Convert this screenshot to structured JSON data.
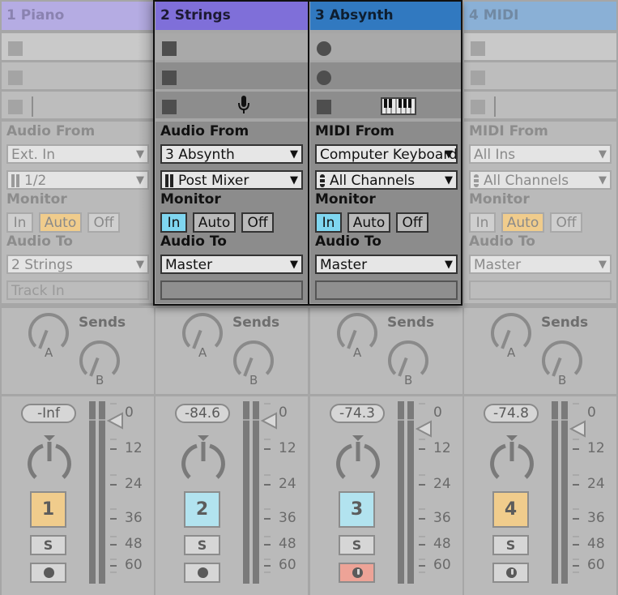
{
  "tracks": [
    {
      "name": "1 Piano",
      "selected": false,
      "header_color": "#b5ace3",
      "header_text_color": "#8a82b0",
      "clip_slots": [
        {
          "type": "stop"
        },
        {
          "type": "stop"
        },
        {
          "type": "stop",
          "extra": "divider-bar"
        }
      ],
      "input_label": "Audio From",
      "input_type": "Ext. In",
      "input_channel": "1/2",
      "input_channel_icon": "stereo-input-icon",
      "monitor_label": "Monitor",
      "monitor_options": [
        "In",
        "Auto",
        "Off"
      ],
      "monitor_active": "Auto",
      "output_label": "Audio To",
      "output_target": "2 Strings",
      "output_sub": "Track In",
      "sends_label": "Sends",
      "sends": [
        {
          "name": "A"
        },
        {
          "name": "B"
        }
      ],
      "volume": "-Inf",
      "track_number": "1",
      "activator_color": "#f0cc8c",
      "solo_label": "S",
      "arm_icon": "record-arm-icon",
      "arm_active": false,
      "meter_scale": [
        "0",
        "12",
        "24",
        "36",
        "48",
        "60"
      ]
    },
    {
      "name": "2 Strings",
      "selected": true,
      "header_color": "#7f6fd9",
      "header_text_color": "#1d1a33",
      "clip_slots": [
        {
          "type": "stop"
        },
        {
          "type": "stop"
        },
        {
          "type": "stop",
          "extra": "microphone-icon"
        }
      ],
      "input_label": "Audio From",
      "input_type": "3 Absynth",
      "input_channel": "Post Mixer",
      "input_channel_icon": "stereo-input-icon",
      "monitor_label": "Monitor",
      "monitor_options": [
        "In",
        "Auto",
        "Off"
      ],
      "monitor_active": "In",
      "output_label": "Audio To",
      "output_target": "Master",
      "output_sub": "",
      "sends_label": "Sends",
      "sends": [
        {
          "name": "A"
        },
        {
          "name": "B"
        }
      ],
      "volume": "-84.6",
      "track_number": "2",
      "activator_color": "#b2e3ef",
      "solo_label": "S",
      "arm_icon": "record-arm-icon",
      "arm_active": false,
      "meter_scale": [
        "0",
        "12",
        "24",
        "36",
        "48",
        "60"
      ]
    },
    {
      "name": "3 Absynth",
      "selected": true,
      "header_color": "#3179c0",
      "header_text_color": "#0e1e30",
      "clip_slots": [
        {
          "type": "record"
        },
        {
          "type": "record"
        },
        {
          "type": "stop",
          "extra": "keyboard-icon"
        }
      ],
      "input_label": "MIDI From",
      "input_type": "Computer Keyboard",
      "input_channel": "All Channels",
      "input_channel_icon": "midi-channel-icon",
      "monitor_label": "Monitor",
      "monitor_options": [
        "In",
        "Auto",
        "Off"
      ],
      "monitor_active": "In",
      "output_label": "Audio To",
      "output_target": "Master",
      "output_sub": "",
      "sends_label": "Sends",
      "sends": [
        {
          "name": "A"
        },
        {
          "name": "B"
        }
      ],
      "volume": "-74.3",
      "track_number": "3",
      "activator_color": "#b2e3ef",
      "solo_label": "S",
      "arm_icon": "midi-arm-icon",
      "arm_active": true,
      "meter_scale": [
        "0",
        "12",
        "24",
        "36",
        "48",
        "60"
      ]
    },
    {
      "name": "4 MIDI",
      "selected": false,
      "header_color": "#8ab0d6",
      "header_text_color": "#7189a3",
      "clip_slots": [
        {
          "type": "stop"
        },
        {
          "type": "stop"
        },
        {
          "type": "stop",
          "extra": "divider-bar"
        }
      ],
      "input_label": "MIDI From",
      "input_type": "All Ins",
      "input_channel": "All Channels",
      "input_channel_icon": "midi-channel-icon",
      "monitor_label": "Monitor",
      "monitor_options": [
        "In",
        "Auto",
        "Off"
      ],
      "monitor_active": "Auto",
      "output_label": "Audio To",
      "output_target": "Master",
      "output_sub": "",
      "sends_label": "Sends",
      "sends": [
        {
          "name": "A"
        },
        {
          "name": "B"
        }
      ],
      "volume": "-74.8",
      "track_number": "4",
      "activator_color": "#f0cc8c",
      "solo_label": "S",
      "arm_icon": "midi-arm-icon",
      "arm_active": false,
      "meter_scale": [
        "0",
        "12",
        "24",
        "36",
        "48",
        "60"
      ]
    }
  ],
  "colors": {
    "monitor_in_active": "#7fd6f0",
    "monitor_auto_active": "#f0cc8c",
    "arm_active": "#eda397"
  }
}
